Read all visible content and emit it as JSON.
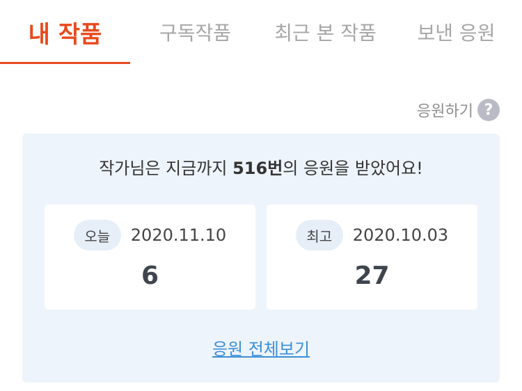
{
  "tabs": [
    {
      "label": "내 작품",
      "active": true
    },
    {
      "label": "구독작품",
      "active": false
    },
    {
      "label": "최근 본 작품",
      "active": false
    },
    {
      "label": "보낸 응원",
      "active": false
    }
  ],
  "help": {
    "label": "응원하기",
    "icon": "question-icon",
    "icon_glyph": "?"
  },
  "summary": {
    "prefix": "작가님은 지금까지 ",
    "count": "516번",
    "suffix": "의 응원을 받았어요!"
  },
  "cards": {
    "today": {
      "badge": "오늘",
      "date": "2020.11.10",
      "value": "6"
    },
    "best": {
      "badge": "최고",
      "date": "2020.10.03",
      "value": "27"
    }
  },
  "view_all_label": "응원 전체보기",
  "colors": {
    "accent": "#e8491d",
    "link": "#3a8fd6",
    "panel_bg": "#eef4fb"
  }
}
